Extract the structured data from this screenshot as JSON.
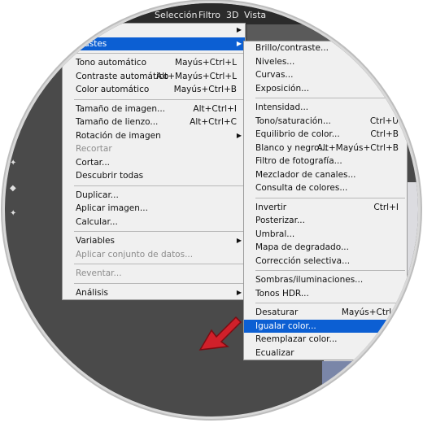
{
  "menubar": {
    "items": [
      "Selección",
      "Filtro",
      "3D",
      "Vista"
    ]
  },
  "main_menu": {
    "rows": [
      {
        "label": "",
        "shortcut": "",
        "submenu": true
      },
      {
        "label": "Ajustes",
        "shortcut": "",
        "submenu": true,
        "highlight": true
      },
      {
        "sep": true
      },
      {
        "label": "Tono automático",
        "shortcut": "Mayús+Ctrl+L"
      },
      {
        "label": "Contraste automático",
        "shortcut": "Alt+Mayús+Ctrl+L"
      },
      {
        "label": "Color automático",
        "shortcut": "Mayús+Ctrl+B"
      },
      {
        "sep": true
      },
      {
        "label": "Tamaño de imagen...",
        "shortcut": "Alt+Ctrl+I"
      },
      {
        "label": "Tamaño de lienzo...",
        "shortcut": "Alt+Ctrl+C"
      },
      {
        "label": "Rotación de imagen",
        "shortcut": "",
        "submenu": true
      },
      {
        "label": "Recortar",
        "shortcut": "",
        "disabled": true
      },
      {
        "label": "Cortar...",
        "shortcut": ""
      },
      {
        "label": "Descubrir todas",
        "shortcut": ""
      },
      {
        "sep": true
      },
      {
        "label": "Duplicar...",
        "shortcut": ""
      },
      {
        "label": "Aplicar imagen...",
        "shortcut": ""
      },
      {
        "label": "Calcular...",
        "shortcut": ""
      },
      {
        "sep": true
      },
      {
        "label": "Variables",
        "shortcut": "",
        "submenu": true
      },
      {
        "label": "Aplicar conjunto de datos...",
        "shortcut": "",
        "disabled": true
      },
      {
        "sep": true
      },
      {
        "label": "Reventar...",
        "shortcut": "",
        "disabled": true
      },
      {
        "sep": true
      },
      {
        "label": "Análisis",
        "shortcut": "",
        "submenu": true
      }
    ]
  },
  "sub_menu": {
    "rows": [
      {
        "label": "Brillo/contraste...",
        "shortcut": ""
      },
      {
        "label": "Niveles...",
        "shortcut": ""
      },
      {
        "label": "Curvas...",
        "shortcut": ""
      },
      {
        "label": "Exposición...",
        "shortcut": ""
      },
      {
        "sep": true
      },
      {
        "label": "Intensidad...",
        "shortcut": ""
      },
      {
        "label": "Tono/saturación...",
        "shortcut": "Ctrl+U"
      },
      {
        "label": "Equilibrio de color...",
        "shortcut": "Ctrl+B"
      },
      {
        "label": "Blanco y negro...",
        "shortcut": "Alt+Mayús+Ctrl+B"
      },
      {
        "label": "Filtro de fotografía...",
        "shortcut": ""
      },
      {
        "label": "Mezclador de canales...",
        "shortcut": ""
      },
      {
        "label": "Consulta de colores...",
        "shortcut": ""
      },
      {
        "sep": true
      },
      {
        "label": "Invertir",
        "shortcut": "Ctrl+I"
      },
      {
        "label": "Posterizar...",
        "shortcut": ""
      },
      {
        "label": "Umbral...",
        "shortcut": ""
      },
      {
        "label": "Mapa de degradado...",
        "shortcut": ""
      },
      {
        "label": "Corrección selectiva...",
        "shortcut": ""
      },
      {
        "sep": true
      },
      {
        "label": "Sombras/iluminaciones...",
        "shortcut": ""
      },
      {
        "label": "Tonos HDR...",
        "shortcut": ""
      },
      {
        "sep": true
      },
      {
        "label": "Desaturar",
        "shortcut": "Mayús+Ctrl+"
      },
      {
        "label": "Igualar color...",
        "shortcut": "",
        "highlight": true
      },
      {
        "label": "Reemplazar color...",
        "shortcut": ""
      },
      {
        "label": "Ecualizar",
        "shortcut": ""
      }
    ]
  },
  "colors": {
    "highlight": "#0c5fd3",
    "menu_bg": "#f0f0f0",
    "arrow": "#d0202a",
    "canvas": "#4a4a4a"
  },
  "icons": {
    "pointer": "red-arrow-icon",
    "submenu": "submenu-arrow-icon"
  }
}
